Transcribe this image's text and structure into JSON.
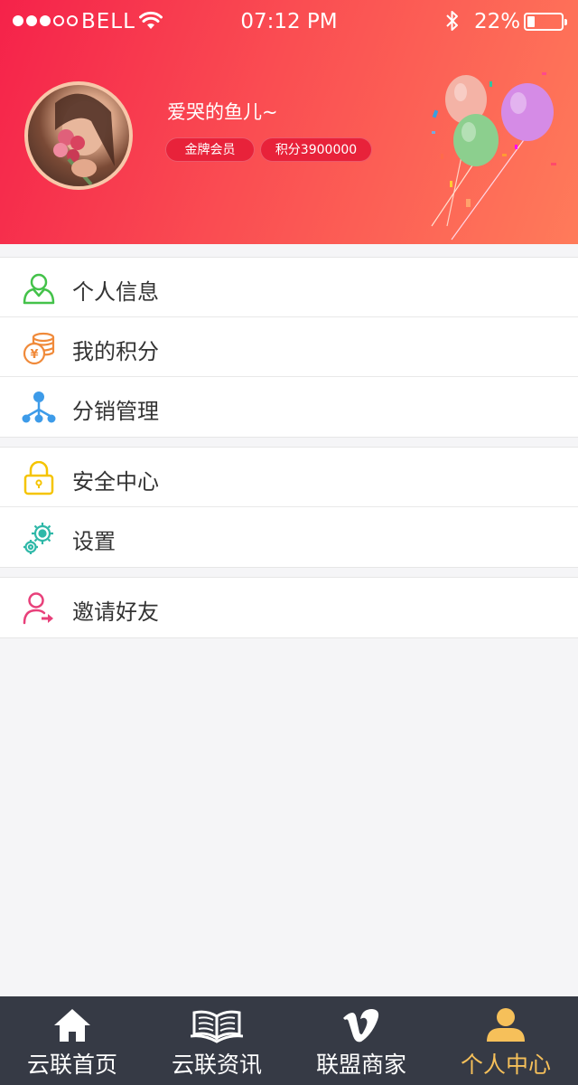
{
  "status_bar": {
    "carrier": "BELL",
    "time": "07:12 PM",
    "battery": "22%",
    "battery_level": 0.22,
    "signal_bars_filled": 3,
    "signal_bars_total": 5
  },
  "profile": {
    "username": "爱哭的鱼儿~",
    "member_level": "金牌会员",
    "points": "积分3900000"
  },
  "menu_groups": [
    {
      "items": [
        {
          "label": "个人信息",
          "icon": "user-icon"
        },
        {
          "label": "我的积分",
          "icon": "coins-icon"
        },
        {
          "label": "分销管理",
          "icon": "network-icon"
        }
      ]
    },
    {
      "items": [
        {
          "label": "安全中心",
          "icon": "lock-icon"
        },
        {
          "label": "设置",
          "icon": "gear-icon"
        }
      ]
    },
    {
      "items": [
        {
          "label": "邀请好友",
          "icon": "invite-user-icon"
        }
      ]
    }
  ],
  "tabbar": {
    "tabs": [
      {
        "label": "云联首页",
        "icon": "home-icon"
      },
      {
        "label": "云联资讯",
        "icon": "book-icon"
      },
      {
        "label": "联盟商家",
        "icon": "vimeo-icon"
      },
      {
        "label": "个人中心",
        "icon": "person-icon"
      }
    ],
    "active_index": 3
  },
  "colors": {
    "header_start": "#f5224a",
    "header_end": "#ff7b5a",
    "tabbar_bg": "#363a45",
    "tab_active": "#f6c05a",
    "badge_bg": "#e8223a"
  }
}
